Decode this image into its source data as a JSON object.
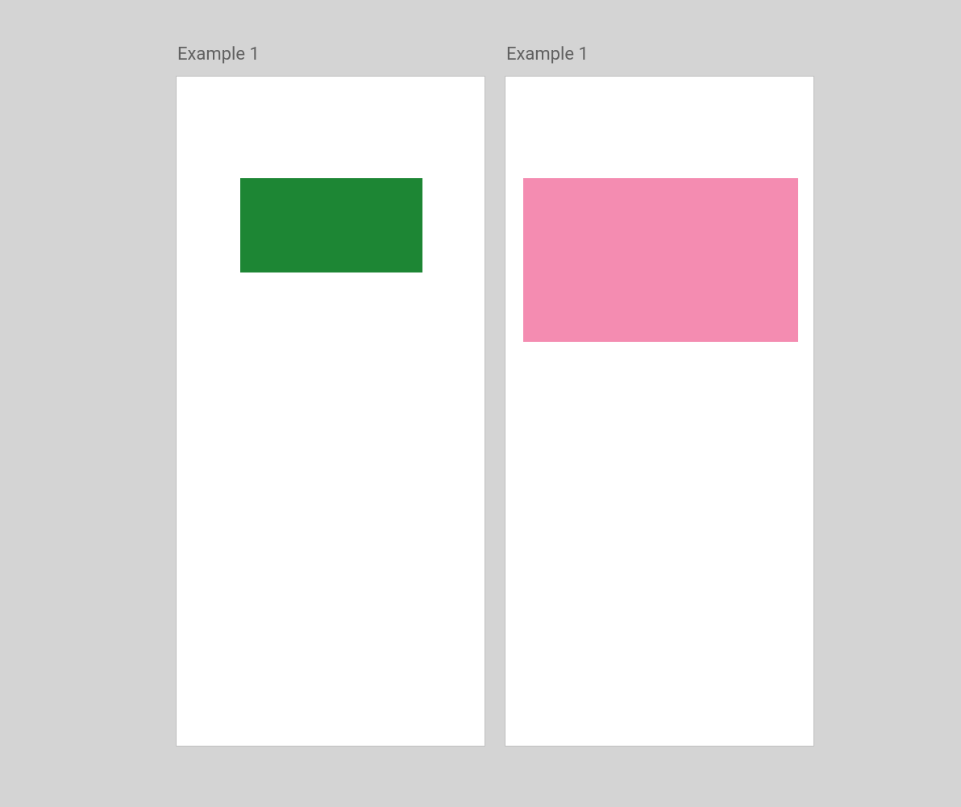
{
  "examples": [
    {
      "label": "Example 1",
      "rect": {
        "name": "green-rectangle",
        "color": "#1d8634"
      }
    },
    {
      "label": "Example 1",
      "rect": {
        "name": "pink-rectangle",
        "color": "#f48cb1"
      }
    }
  ]
}
